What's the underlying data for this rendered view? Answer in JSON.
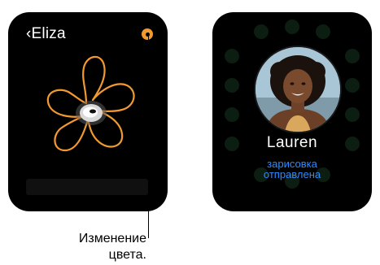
{
  "left_watch": {
    "back_label": "‹Eliza",
    "color_picker_color": "#f39a2e",
    "sketch_stroke_color": "#f39a2e",
    "sketch_icon": "flower-sketch"
  },
  "right_watch": {
    "contact_name": "Lauren",
    "status_line_1": "зарисовка",
    "status_line_2": "отправлена",
    "status_color": "#2e8bff",
    "avatar_icon": "contact-photo"
  },
  "callout": {
    "line_1": "Изменение",
    "line_2": "цвета."
  }
}
